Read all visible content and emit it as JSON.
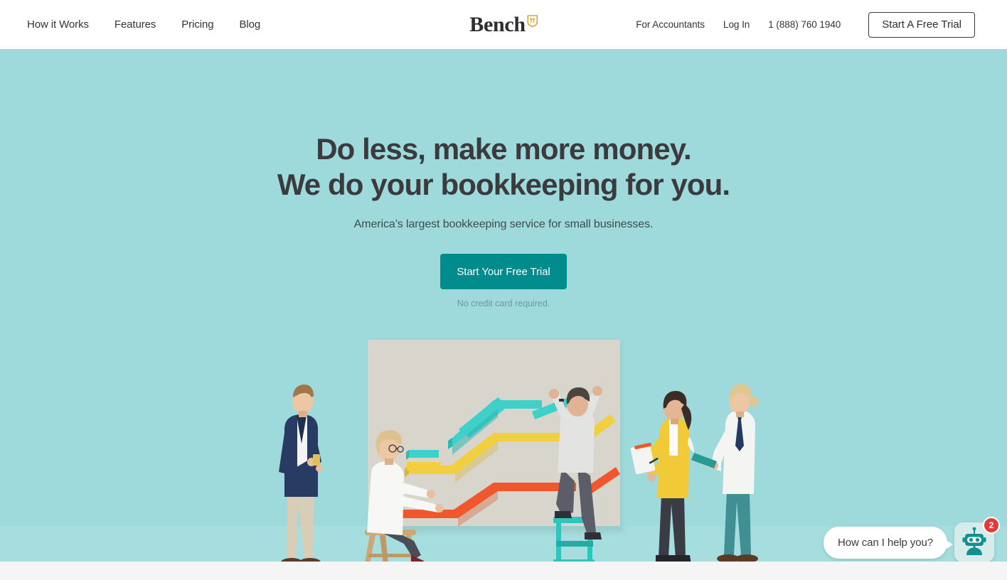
{
  "header": {
    "nav_links": [
      {
        "label": "How it Works",
        "name": "nav-how-it-works"
      },
      {
        "label": "Features",
        "name": "nav-features"
      },
      {
        "label": "Pricing",
        "name": "nav-pricing"
      },
      {
        "label": "Blog",
        "name": "nav-blog"
      }
    ],
    "logo": {
      "text": "Bench",
      "icon": "bench-shield-icon",
      "shield_color": "#d9a441"
    },
    "for_accountants": "For Accountants",
    "log_in": "Log In",
    "phone": "1 (888) 760 1940",
    "trial_button": "Start A Free Trial"
  },
  "hero": {
    "headline_line1": "Do less, make more money.",
    "headline_line2": "We do your bookkeeping for you.",
    "subheadline": "America’s largest bookkeeping service for small businesses.",
    "cta_label": "Start Your Free Trial",
    "no_card_note": "No credit card required.",
    "background_color": "#9ed9dc",
    "cta_color": "#008c8c"
  },
  "illustration": {
    "alt": "People mounting colored chart lines on a wall",
    "wall_color": "#d8d5cd",
    "line_colors": [
      "#3fd0c9",
      "#f2cf3f",
      "#f0572d"
    ]
  },
  "chat": {
    "bubble_text": "How can I help you?",
    "avatar_icon": "robot-icon",
    "unread_count": "2",
    "badge_color": "#e23b3b",
    "robot_color": "#138f8f"
  }
}
